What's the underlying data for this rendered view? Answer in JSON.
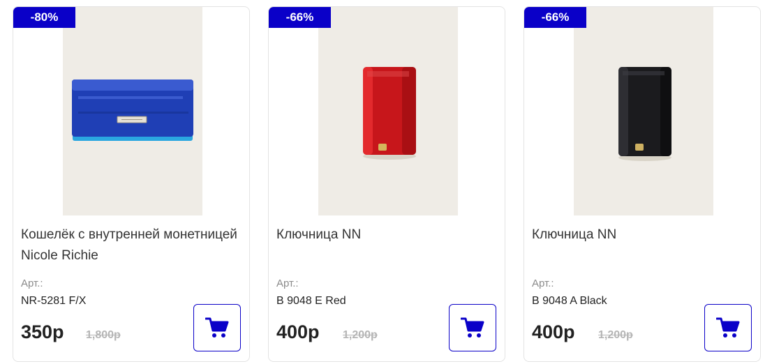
{
  "products": [
    {
      "discount": "-80%",
      "title": "Кошелёк с внутренней монетницей Nicole Richie",
      "art_label": "Арт.:",
      "art": "NR-5281 F/X",
      "price": "350р",
      "old_price": "1,800р",
      "photo": "blue-lacquer-wallet"
    },
    {
      "discount": "-66%",
      "title": "Ключница NN",
      "art_label": "Арт.:",
      "art": "B 9048 E Red",
      "price": "400р",
      "old_price": "1,200р",
      "photo": "red-croc-key-holder"
    },
    {
      "discount": "-66%",
      "title": "Ключница NN",
      "art_label": "Арт.:",
      "art": "B 9048 A Black",
      "price": "400р",
      "old_price": "1,200р",
      "photo": "black-croc-key-holder"
    }
  ],
  "colors": {
    "accent": "#0a00c8",
    "badge_text": "#ffffff",
    "old_price": "#b5b5b5"
  },
  "icons": {
    "cart": "shopping-cart-icon"
  }
}
